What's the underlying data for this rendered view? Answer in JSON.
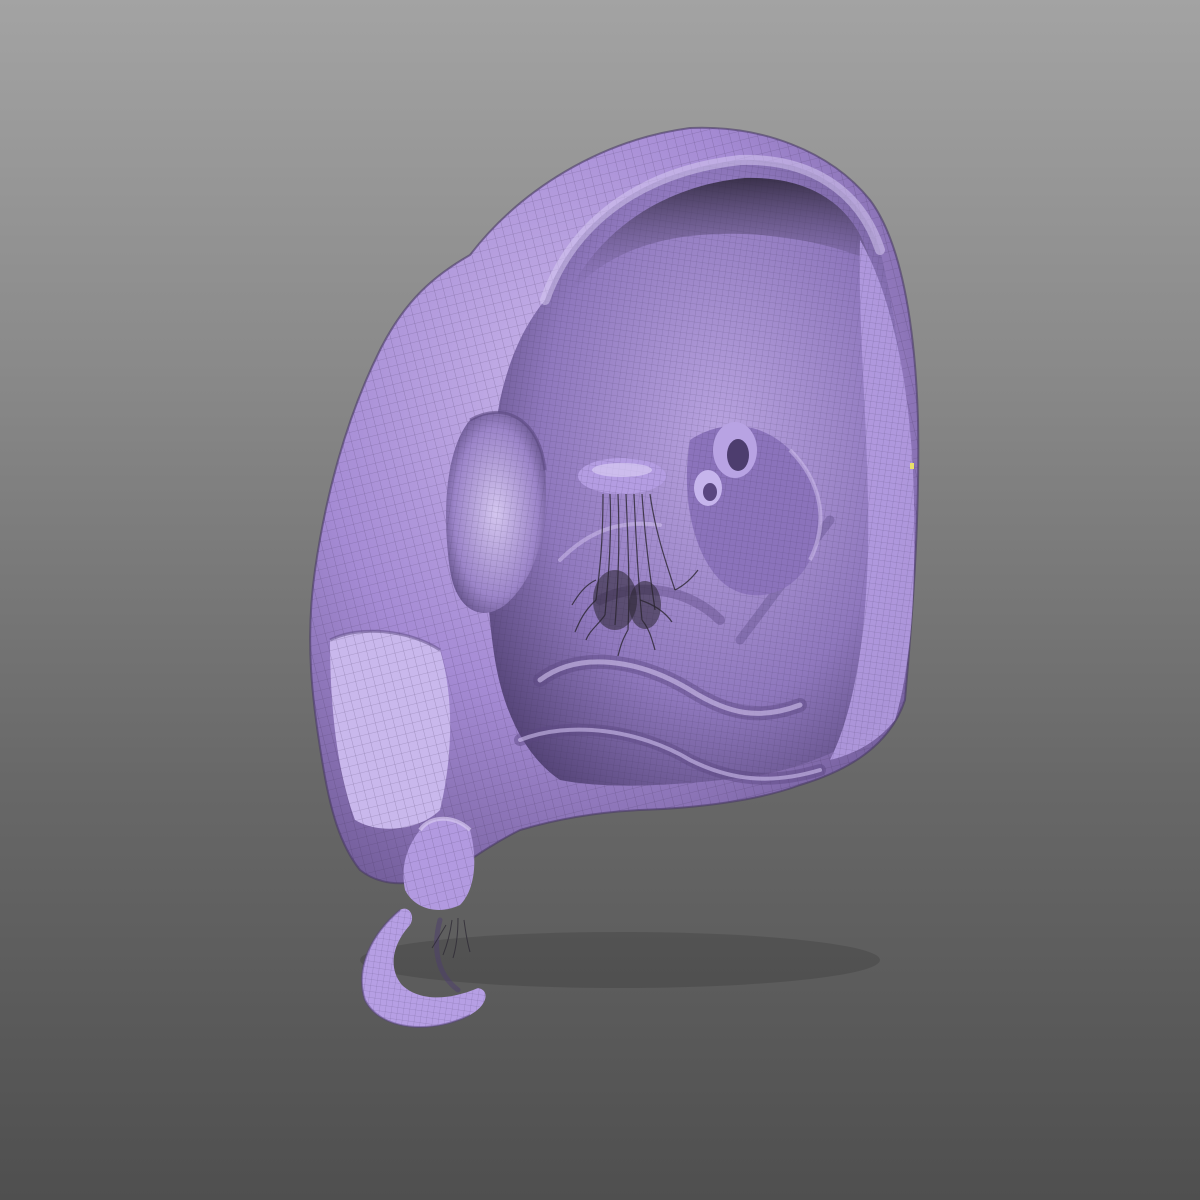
{
  "viewport": {
    "background_top": "#a3a3a3",
    "background_bottom": "#4f4f4f"
  },
  "model": {
    "material_color": "#a88ed6",
    "shadow_color": "#4a3a66",
    "highlight_color": "#d6c8f0",
    "wireframe_color": "#3b2f52",
    "hair_color": "#2a2530",
    "marker_color": "#e9e06a"
  }
}
